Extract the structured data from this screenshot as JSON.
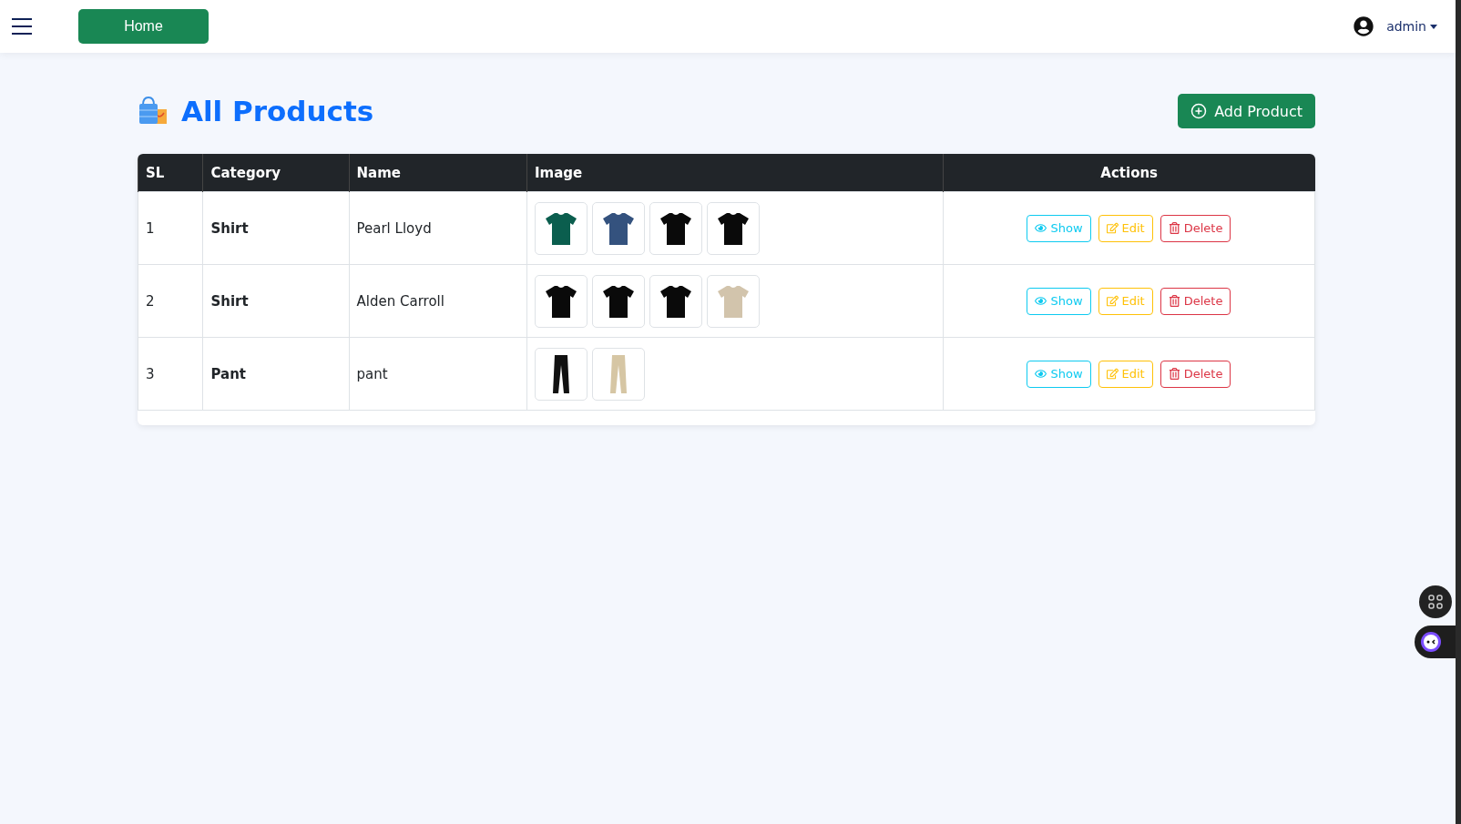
{
  "navbar": {
    "home": "Home",
    "user": "admin"
  },
  "page": {
    "title": "All Products",
    "add_button": "Add Product"
  },
  "table": {
    "columns": [
      "SL",
      "Category",
      "Name",
      "Image",
      "Actions"
    ],
    "rows": [
      {
        "sl": "1",
        "category": "Shirt",
        "name": "Pearl Lloyd",
        "images": [
          {
            "kind": "shirt",
            "color": "#0b5e4e"
          },
          {
            "kind": "shirt",
            "color": "#34527e"
          },
          {
            "kind": "shirt",
            "color": "#0a0a0a"
          },
          {
            "kind": "shirt",
            "color": "#0a0a0a"
          }
        ],
        "actions": [
          "Show",
          "Edit",
          "Delete"
        ]
      },
      {
        "sl": "2",
        "category": "Shirt",
        "name": "Alden Carroll",
        "images": [
          {
            "kind": "shirt",
            "color": "#0a0a0a"
          },
          {
            "kind": "shirt",
            "color": "#0a0a0a"
          },
          {
            "kind": "shirt",
            "color": "#0a0a0a"
          },
          {
            "kind": "shirt",
            "color": "#d2c4ac"
          }
        ],
        "actions": [
          "Show",
          "Edit",
          "Delete"
        ]
      },
      {
        "sl": "3",
        "category": "Pant",
        "name": "pant",
        "images": [
          {
            "kind": "pant",
            "color": "#111111"
          },
          {
            "kind": "pant",
            "color": "#d6c6a4"
          }
        ],
        "actions": [
          "Show",
          "Edit",
          "Delete"
        ]
      }
    ]
  }
}
